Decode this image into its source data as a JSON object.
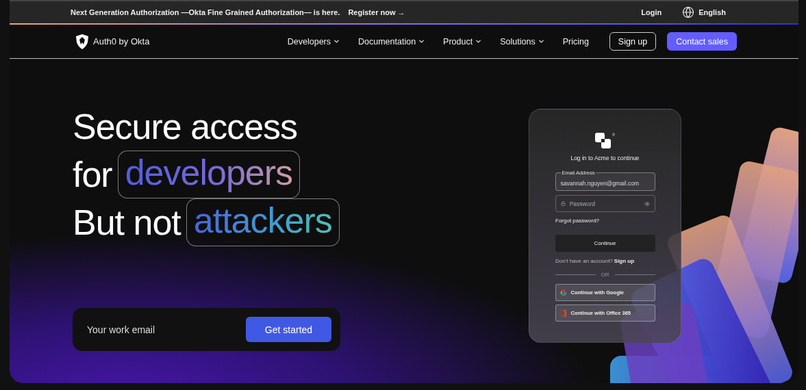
{
  "announcement": {
    "text": "Next Generation Authorization —Okta Fine Grained Authorization— is here.",
    "link": "Register now →"
  },
  "top_links": {
    "login": "Login",
    "language": "English"
  },
  "nav": {
    "brand": "Auth0 by Okta",
    "items": [
      {
        "label": "Developers",
        "dropdown": true
      },
      {
        "label": "Documentation",
        "dropdown": true
      },
      {
        "label": "Product",
        "dropdown": true
      },
      {
        "label": "Solutions",
        "dropdown": true
      },
      {
        "label": "Pricing",
        "dropdown": false
      }
    ],
    "sign_up": "Sign up",
    "contact_sales": "Contact sales"
  },
  "hero": {
    "headline": [
      {
        "text": "Secure access"
      },
      {
        "text": "for",
        "highlight": "developers"
      },
      {
        "text": "But not",
        "highlight": "attackers"
      }
    ],
    "email_placeholder": "Your work email",
    "cta": "Get started"
  },
  "login_card": {
    "trademark": "®",
    "title": "Log in to Acme to continue",
    "email_label": "Email Address",
    "email_value": "savannah.nguyen@gmail.com",
    "password_placeholder": "Password",
    "forgot": "Forgot password?",
    "continue": "Continue",
    "no_account": "Don't have an account?",
    "sign_up": "Sign up",
    "divider": "OR",
    "providers": [
      {
        "label": "Continue with Google",
        "kind": "google"
      },
      {
        "label": "Continue with Office 365",
        "kind": "office"
      }
    ]
  }
}
